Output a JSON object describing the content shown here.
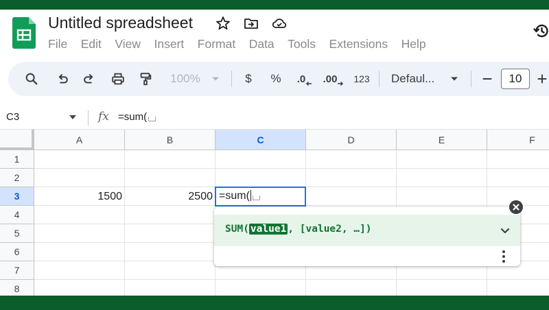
{
  "doc": {
    "title": "Untitled spreadsheet"
  },
  "menu": [
    "File",
    "Edit",
    "View",
    "Insert",
    "Format",
    "Data",
    "Tools",
    "Extensions",
    "Help"
  ],
  "toolbar": {
    "zoom": "100%",
    "currency": "$",
    "percent": "%",
    "dec_decrease": ".0",
    "dec_increase": ".00",
    "more_formats": "123",
    "font": "Defaul...",
    "font_size": "10"
  },
  "formula_bar": {
    "name_box": "C3",
    "fx": "fx",
    "formula": "=sum("
  },
  "grid": {
    "columns": [
      "A",
      "B",
      "C",
      "D",
      "E",
      "F"
    ],
    "rows": [
      "1",
      "2",
      "3",
      "4",
      "5",
      "6",
      "7",
      "8"
    ],
    "selected_column": "C",
    "selected_row": "3",
    "cells": {
      "A3": "1500",
      "B3": "2500",
      "C3": "=sum("
    }
  },
  "autocomplete": {
    "fn_open": "SUM(",
    "param_current": "value1",
    "rest": ", [value2, …])"
  },
  "colors": {
    "brand_green": "#0b5d2c",
    "selection_blue": "#1a73e8",
    "hint_green": "#137333",
    "hint_bg": "#e6f4ea"
  },
  "icons": [
    "sheets-logo",
    "star-icon",
    "move-to-folder-icon",
    "cloud-saved-icon",
    "version-history-icon",
    "search-icon",
    "undo-icon",
    "redo-icon",
    "print-icon",
    "paint-format-icon",
    "chevron-down-icon",
    "minus-icon",
    "plus-icon",
    "close-icon",
    "more-vert-icon"
  ]
}
